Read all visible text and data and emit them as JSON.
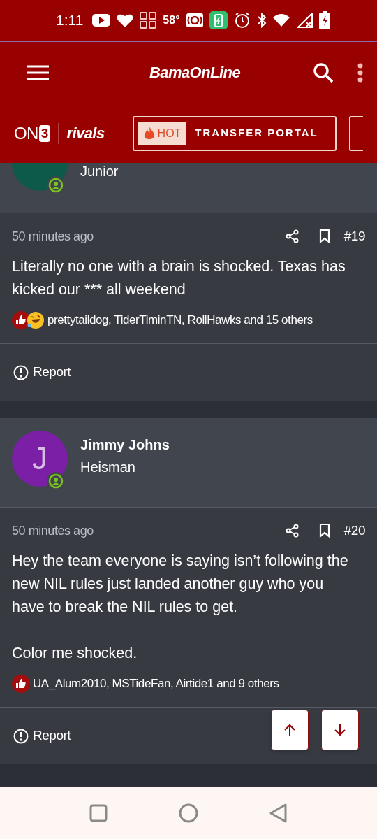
{
  "status_bar": {
    "time": "1:11",
    "temperature": "58°"
  },
  "header": {
    "logo": "BamaOnLine"
  },
  "brand_bar": {
    "on3_letters": "ON",
    "on3_digit": "3",
    "rivals": "rivals",
    "promo": {
      "badge": "HOT",
      "label": "TRANSFER PORTAL"
    }
  },
  "posts": [
    {
      "user": {
        "color": "#0e5a48",
        "rank": "Junior"
      },
      "time": "50 minutes ago",
      "number": "#19",
      "body": [
        "Literally no one with a brain is shocked. Texas has kicked our *** all weekend"
      ],
      "reactions": {
        "icons": [
          {
            "kind": "like"
          },
          {
            "kind": "laugh"
          }
        ],
        "text": "prettytaildog, TiderTiminTN, RollHawks and 15 others"
      },
      "report": "Report"
    },
    {
      "user": {
        "avatar_letter": "J",
        "color": "#7a1fa6",
        "name": "Jimmy Johns",
        "rank": "Heisman"
      },
      "time": "50 minutes ago",
      "number": "#20",
      "body": [
        "Hey the team everyone is saying isn’t following the new NIL rules just landed another guy who you have to break the NIL rules to get.",
        "Color me shocked."
      ],
      "reactions": {
        "icons": [
          {
            "kind": "like"
          }
        ],
        "text": "UA_Alum2010, MSTideFan, Airtide1 and 9 others"
      },
      "report": "Report"
    }
  ]
}
